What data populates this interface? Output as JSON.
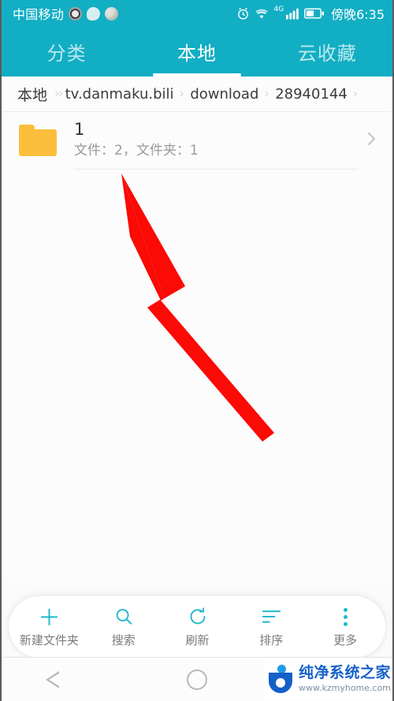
{
  "status_bar": {
    "carrier": "中国移动",
    "time": "傍晚6:35",
    "network_label": "4G",
    "icons": [
      "paw-app-icon",
      "chat-bubble-icon",
      "disk-app-icon",
      "alarm-clock-icon",
      "wifi-icon",
      "cellular-signal-icon",
      "battery-icon"
    ]
  },
  "tabs": [
    {
      "label": "分类",
      "active": false
    },
    {
      "label": "本地",
      "active": true
    },
    {
      "label": "云收藏",
      "active": false
    }
  ],
  "breadcrumb": {
    "root": "本地",
    "items": [
      "tv.danmaku.bili",
      "download",
      "28940144"
    ],
    "separator": "›"
  },
  "file_list": [
    {
      "name": "1",
      "info": "文件：2，文件夹：1",
      "type": "folder",
      "icon_color": "#FBBE3C"
    }
  ],
  "toolbar": [
    {
      "label": "新建文件夹",
      "icon": "plus-icon"
    },
    {
      "label": "搜索",
      "icon": "search-icon"
    },
    {
      "label": "刷新",
      "icon": "refresh-icon"
    },
    {
      "label": "排序",
      "icon": "sort-icon"
    },
    {
      "label": "更多",
      "icon": "more-vertical-icon"
    }
  ],
  "nav_bar": {
    "back": "back-triangle-icon",
    "home": "home-circle-icon"
  },
  "watermark": {
    "name": "纯净系统之家",
    "url": "www.kzmyhome.com"
  },
  "annotation": {
    "type": "red-arrow",
    "color": "#FB0A06",
    "points_to": "folder-list-item"
  },
  "colors": {
    "header_teal": "#12AEC4",
    "accent_teal": "#1EB8C9",
    "folder_orange": "#FBBE3C",
    "arrow_red": "#FB0A06"
  }
}
